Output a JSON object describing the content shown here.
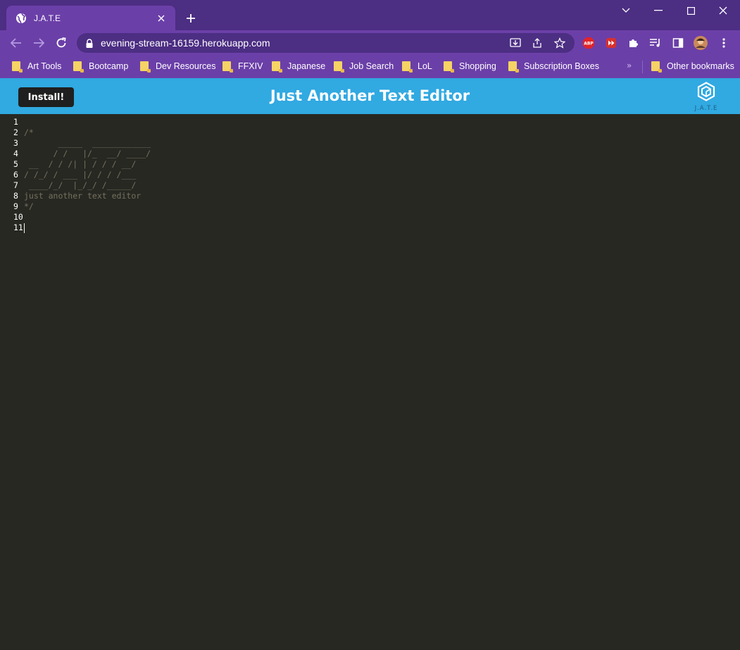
{
  "browser": {
    "tab_title": "J.A.T.E",
    "url": "evening-stream-16159.herokuapp.com",
    "bookmarks": [
      "Art Tools",
      "Bootcamp",
      "Dev Resources",
      "FFXIV",
      "Japanese",
      "Job Search",
      "LoL",
      "Shopping",
      "Subscription Boxes"
    ],
    "other_bookmarks": "Other bookmarks",
    "more_symbol": "»",
    "extension_badge": "ABP"
  },
  "app": {
    "install_label": "Install!",
    "title": "Just Another Text Editor",
    "logo_text": "J.A.T.E",
    "header_color": "#31a9e1"
  },
  "editor": {
    "line_numbers": [
      "1",
      "2",
      "3",
      "4",
      "5",
      "6",
      "7",
      "8",
      "9",
      "10",
      "11"
    ],
    "lines": [
      "",
      "/*",
      "       _____  ____________",
      "      / /   |/_  __/ ____/",
      " __  / / /| | / / / __/",
      "/ /_/ / ___ |/ / / /___",
      " ____/_/  |_/_/ /_____/",
      "just another text editor",
      "*/",
      "",
      ""
    ],
    "background": "#272822",
    "comment_color": "#75715e"
  }
}
